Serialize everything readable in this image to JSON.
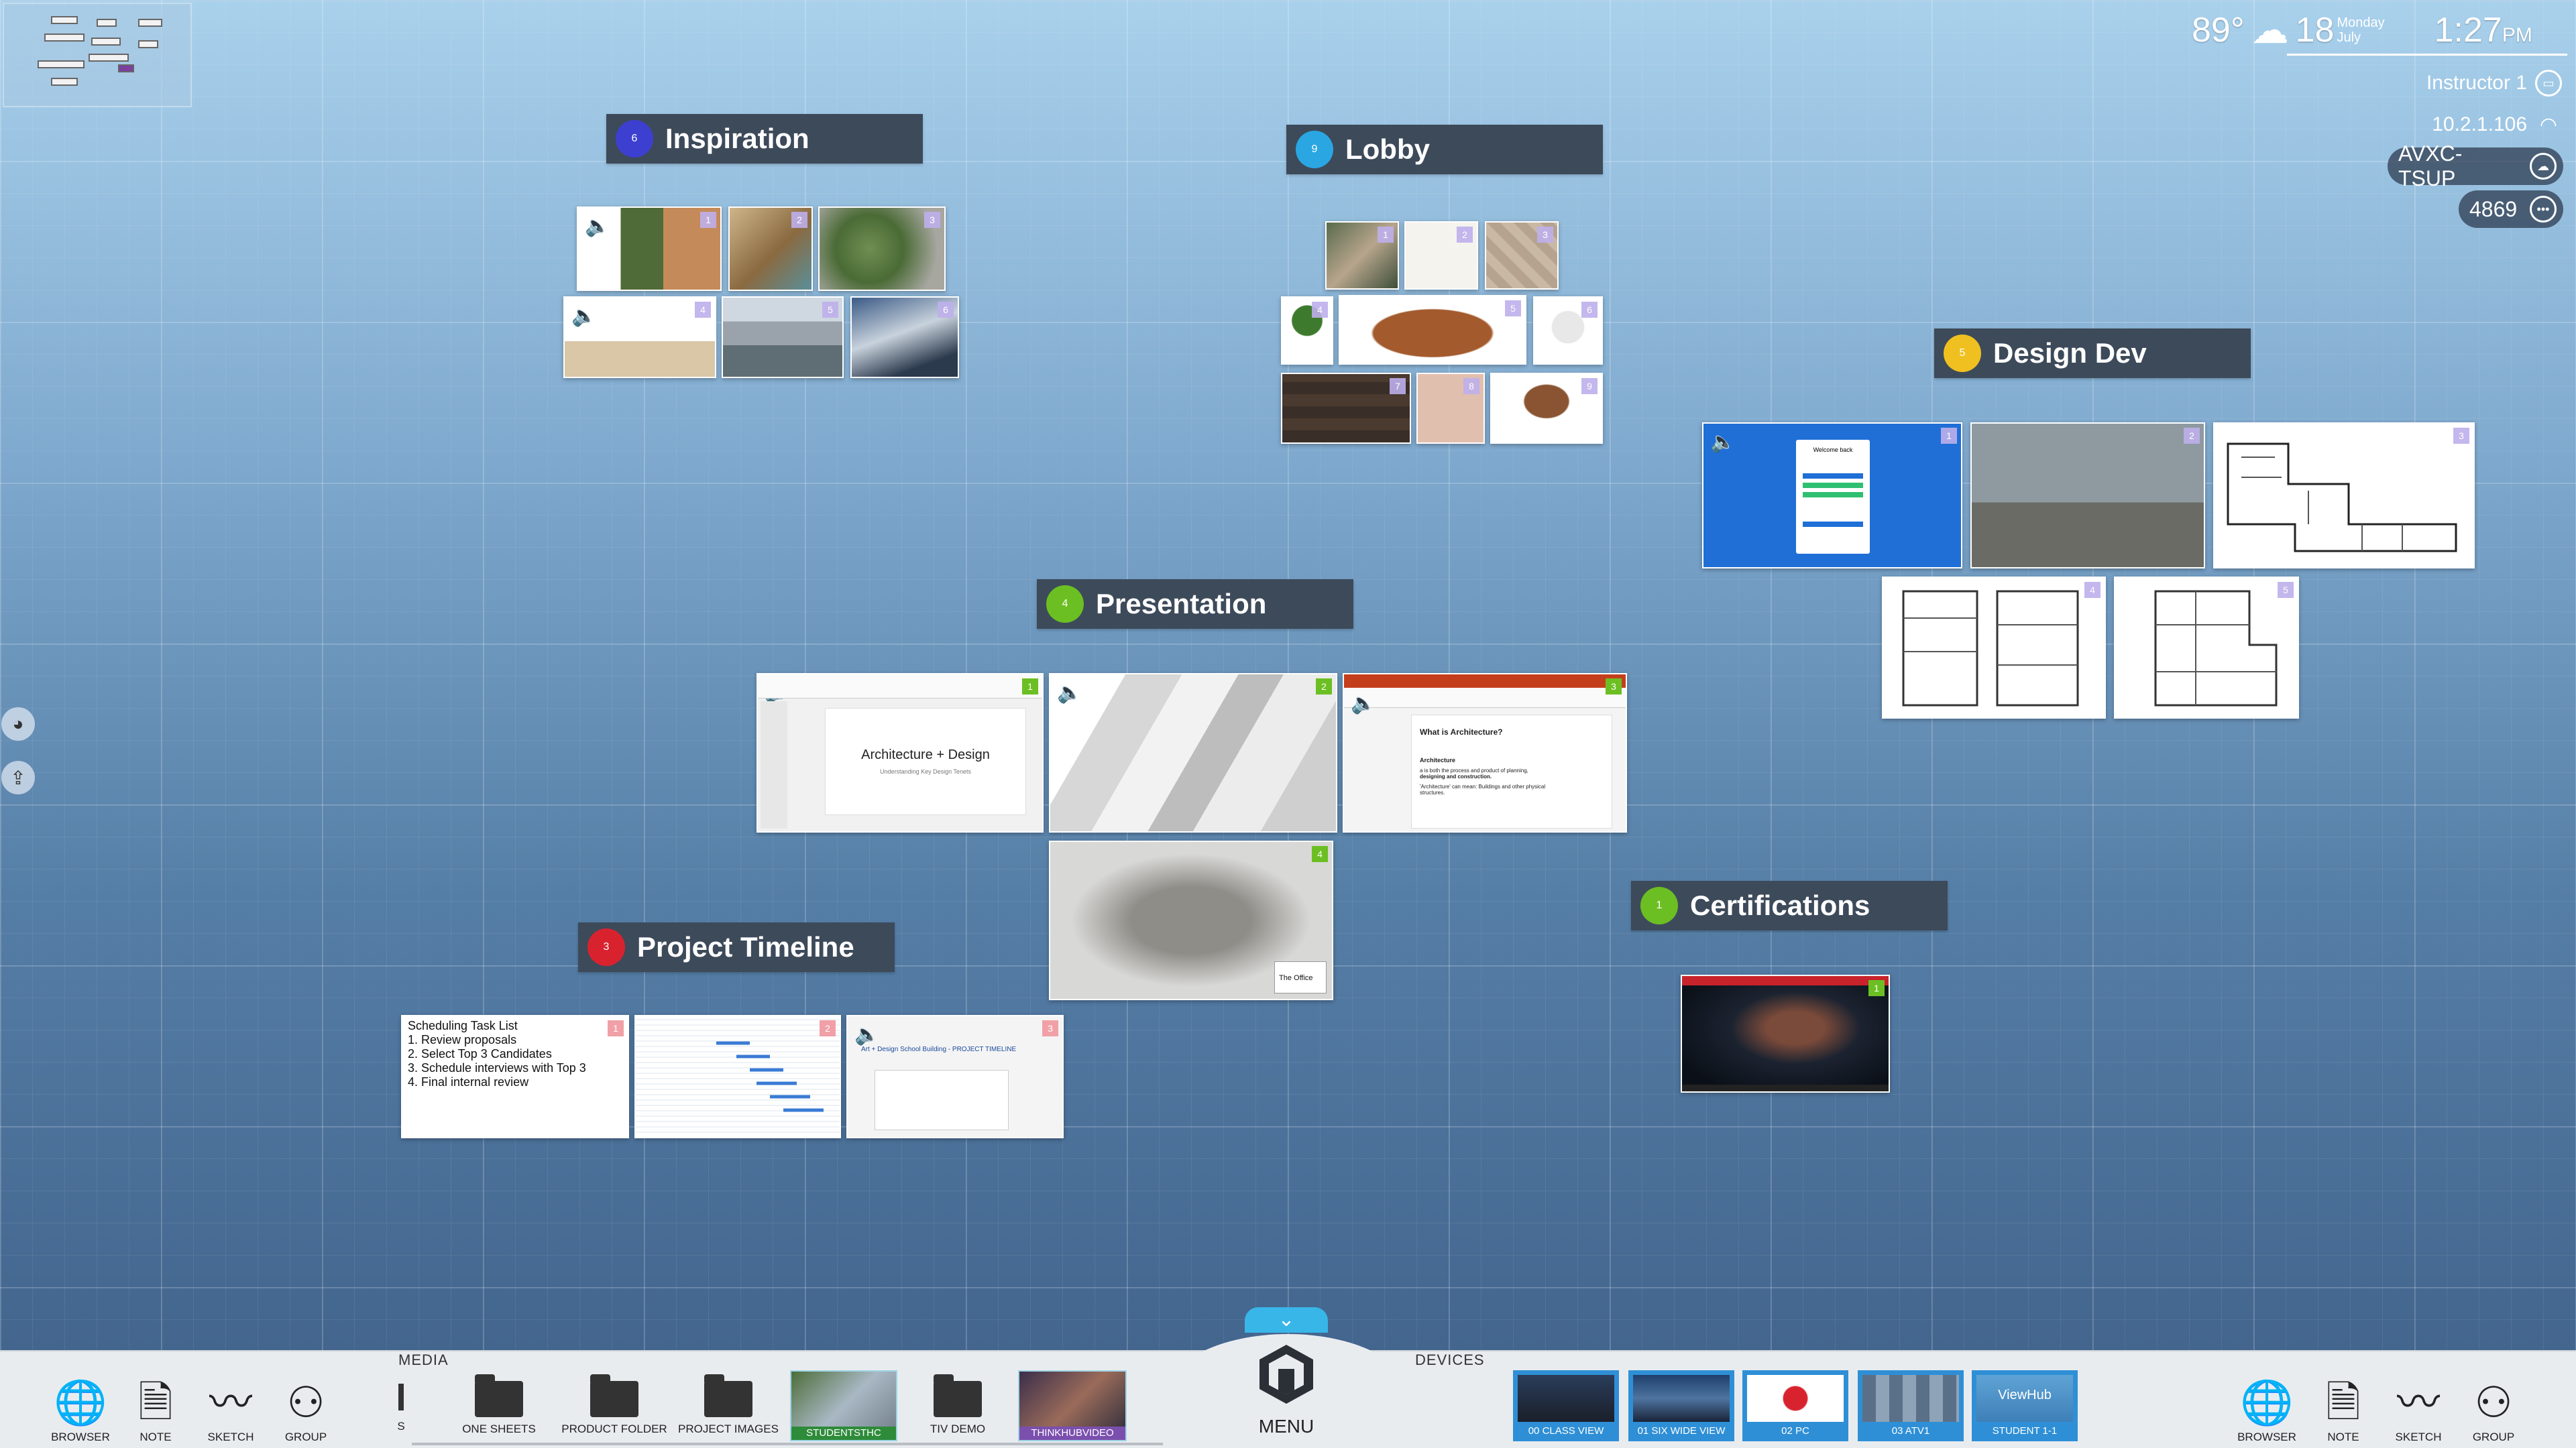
{
  "status": {
    "temperature": "89°",
    "day_number": "18",
    "weekday": "Monday",
    "month": "July",
    "time": "1:27",
    "ampm": "PM",
    "user": "Instructor 1",
    "ip": "10.2.1.106",
    "room": "AVXC-TSUP",
    "code": "4869"
  },
  "groups": {
    "inspiration": {
      "title": "Inspiration",
      "count": "6",
      "color": "#3d3fd1"
    },
    "lobby": {
      "title": "Lobby",
      "count": "9",
      "color": "#2aa7e2"
    },
    "design_dev": {
      "title": "Design Dev",
      "count": "5",
      "color": "#f0c020"
    },
    "presentation": {
      "title": "Presentation",
      "count": "4",
      "color": "#6cbf22"
    },
    "certifications": {
      "title": "Certifications",
      "count": "1",
      "color": "#6cbf22"
    },
    "project_timeline": {
      "title": "Project Timeline",
      "count": "3",
      "color": "#d8232f"
    }
  },
  "presentation_slide": {
    "title": "Architecture + Design",
    "subtitle": "Understanding Key Design Tenets"
  },
  "architecture_doc": {
    "heading": "What is Architecture?",
    "term": "Architecture",
    "line1": "a is both the process and product of planning,",
    "line2": "designing and construction.",
    "line3": "'Architecture' can mean: Buildings and other physical",
    "line4": "structures."
  },
  "task_note": {
    "title": "Scheduling Task List",
    "items": [
      "1. Review proposals",
      "2. Select Top 3 Candidates",
      "3. Schedule interviews with Top 3",
      "4. Final internal review"
    ]
  },
  "timeline_doc": {
    "title": "Art + Design School Building - PROJECT TIMELINE"
  },
  "office_logo": "The Office",
  "welcome_card": "Welcome back",
  "bottom_bar": {
    "media_label": "MEDIA",
    "devices_label": "DEVICES",
    "menu_label": "MENU",
    "left_tools": [
      "BROWSER",
      "NOTE",
      "SKETCH",
      "GROUP"
    ],
    "right_tools": [
      "BROWSER",
      "NOTE",
      "SKETCH",
      "GROUP"
    ],
    "media_items": [
      "S",
      "ONE SHEETS",
      "PRODUCT FOLDER",
      "PROJECT IMAGES",
      "STUDENTSTHC",
      "TIV DEMO",
      "THINKHUBVIDEO"
    ],
    "devices": [
      "00 CLASS VIEW",
      "01 SIX WIDE VIEW",
      "02 PC",
      "03 ATV1",
      "STUDENT 1-1"
    ],
    "viewhub_logo": "ViewHub"
  }
}
